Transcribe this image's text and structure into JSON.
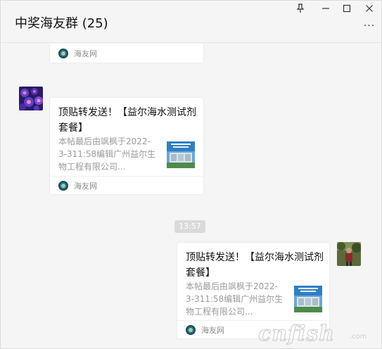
{
  "window": {
    "title": "中奖海友群 (25)",
    "controls": [
      "pin-icon",
      "minimize-icon",
      "maximize-icon",
      "close-icon"
    ],
    "more": "···"
  },
  "messages": [
    {
      "type": "card",
      "sender": "other",
      "source": "海友网",
      "partial": true
    },
    {
      "type": "card",
      "sender": "other",
      "title": "顶贴转发送！【益尔海水测试剂套餐】",
      "desc": "本帖最后由飒枫于2022-3-311:58编辑广州益尔生物工程有限公司...",
      "source": "海友网"
    },
    {
      "type": "time",
      "text": "13:57"
    },
    {
      "type": "card",
      "sender": "self",
      "title": "顶贴转发送！【益尔海水测试剂套餐】",
      "desc": "本帖最后由飒枫于2022-3-311:58编辑广州益尔生物工程有限公司...",
      "source": "海友网"
    }
  ],
  "watermark": "cnfish",
  "watermark_small": ".com",
  "colors": {
    "background": "#f5f5f5",
    "card": "#ffffff",
    "time_badge": "#dadada",
    "muted_text": "#9a9a9a"
  }
}
